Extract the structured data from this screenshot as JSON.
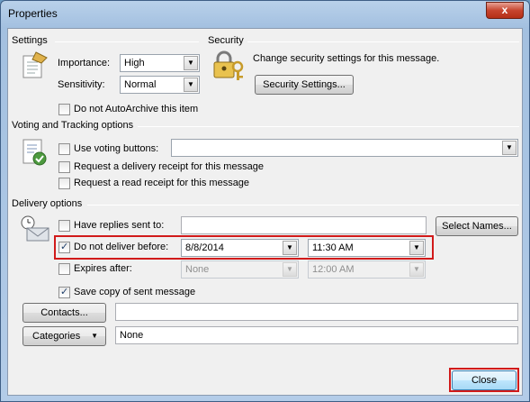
{
  "window": {
    "title": "Properties",
    "close_glyph": "x"
  },
  "settings": {
    "heading": "Settings",
    "importance_label": "Importance:",
    "importance_value": "High",
    "sensitivity_label": "Sensitivity:",
    "sensitivity_value": "Normal",
    "autoarchive_label": "Do not AutoArchive this item",
    "autoarchive_checked": false,
    "icon": "settings-document-icon"
  },
  "security": {
    "heading": "Security",
    "description": "Change security settings for this message.",
    "button_label": "Security Settings...",
    "icon": "lock-key-icon"
  },
  "voting": {
    "heading": "Voting and Tracking options",
    "voting_label": "Use voting buttons:",
    "voting_checked": false,
    "voting_value": "",
    "delivery_receipt_label": "Request a delivery receipt for this message",
    "delivery_receipt_checked": false,
    "read_receipt_label": "Request a read receipt for this message",
    "read_receipt_checked": false,
    "icon": "checklist-icon"
  },
  "delivery": {
    "heading": "Delivery options",
    "replies_label": "Have replies sent to:",
    "replies_checked": false,
    "replies_value": "",
    "select_names_label": "Select Names...",
    "deliver_before_label": "Do not deliver before:",
    "deliver_before_checked": true,
    "deliver_date": "8/8/2014",
    "deliver_time": "11:30 AM",
    "expires_label": "Expires after:",
    "expires_checked": false,
    "expires_date": "None",
    "expires_time": "12:00 AM",
    "save_copy_label": "Save copy of sent message",
    "save_copy_checked": true,
    "icon": "clock-envelope-icon"
  },
  "contacts": {
    "button_label": "Contacts...",
    "value": ""
  },
  "categories": {
    "button_label": "Categories",
    "value": "None"
  },
  "footer": {
    "close_label": "Close"
  },
  "colors": {
    "highlight": "#d11a1a",
    "dialog_bg": "#f0f0f0"
  }
}
